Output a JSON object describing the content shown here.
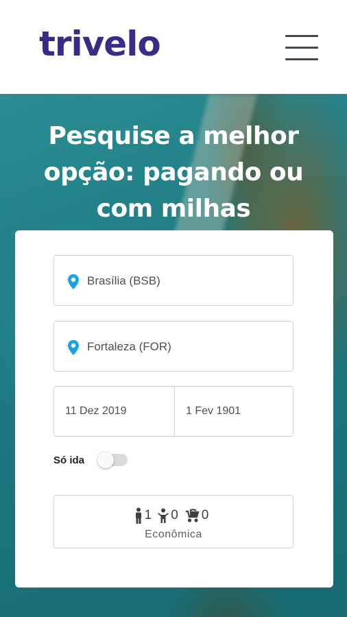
{
  "header": {
    "logo": "trivelo",
    "menu_icon": "hamburger-icon"
  },
  "hero": {
    "title": "Pesquise a melhor opção: pagando ou com milhas"
  },
  "search": {
    "origin": "Brasília (BSB)",
    "destination": "Fortaleza (FOR)",
    "departure_date": "11 Dez 2019",
    "return_date": "1 Fev 1901",
    "one_way_label": "Só ida",
    "one_way_enabled": false,
    "passengers": {
      "adults": "1",
      "children": "0",
      "infants": "0",
      "cabin_class": "Econômica"
    }
  },
  "colors": {
    "brand": "#3b2a86",
    "pin": "#1aa3e0",
    "border": "#cfd3d6"
  }
}
